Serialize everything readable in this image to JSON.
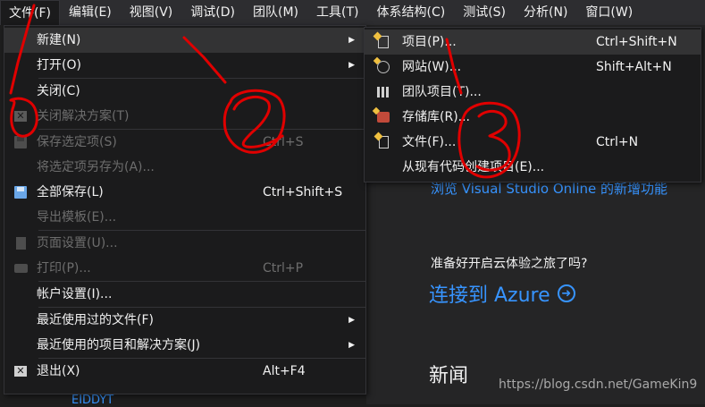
{
  "menubar": {
    "items": [
      "文件(F)",
      "编辑(E)",
      "视图(V)",
      "调试(D)",
      "团队(M)",
      "工具(T)",
      "体系结构(C)",
      "测试(S)",
      "分析(N)",
      "窗口(W)"
    ]
  },
  "file_menu": {
    "new": {
      "label": "新建(N)"
    },
    "open": {
      "label": "打开(O)"
    },
    "close": {
      "label": "关闭(C)"
    },
    "close_solution": {
      "label": "关闭解决方案(T)"
    },
    "save_selected": {
      "label": "保存选定项(S)",
      "shortcut": "Ctrl+S"
    },
    "save_selected_as": {
      "label": "将选定项另存为(A)..."
    },
    "save_all": {
      "label": "全部保存(L)",
      "shortcut": "Ctrl+Shift+S"
    },
    "export_template": {
      "label": "导出模板(E)..."
    },
    "page_setup": {
      "label": "页面设置(U)..."
    },
    "print": {
      "label": "打印(P)...",
      "shortcut": "Ctrl+P"
    },
    "account_settings": {
      "label": "帐户设置(I)..."
    },
    "recent_files": {
      "label": "最近使用过的文件(F)"
    },
    "recent_projects": {
      "label": "最近使用的项目和解决方案(J)"
    },
    "exit": {
      "label": "退出(X)",
      "shortcut": "Alt+F4"
    }
  },
  "new_submenu": {
    "project": {
      "label": "项目(P)...",
      "shortcut": "Ctrl+Shift+N"
    },
    "website": {
      "label": "网站(W)...",
      "shortcut": "Shift+Alt+N"
    },
    "team_project": {
      "label": "团队项目(T)..."
    },
    "repository": {
      "label": "存储库(R)..."
    },
    "file": {
      "label": "文件(F)...",
      "shortcut": "Ctrl+N"
    },
    "from_existing": {
      "label": "从现有代码创建项目(E)..."
    }
  },
  "start_page": {
    "vs_online_link": "浏览 Visual Studio Online 的新增功能",
    "cloud_question": "准备好开启云体验之旅了吗?",
    "azure_link": "连接到 Azure",
    "azure_arrow": "➜",
    "news_heading": "新闻",
    "bottom_link": "EIDDYT"
  },
  "watermark": "https://blog.csdn.net/GameKin9",
  "colors": {
    "accent": "#3794ff",
    "annotation": "#e00000",
    "menu_bg": "#1b1b1c"
  }
}
